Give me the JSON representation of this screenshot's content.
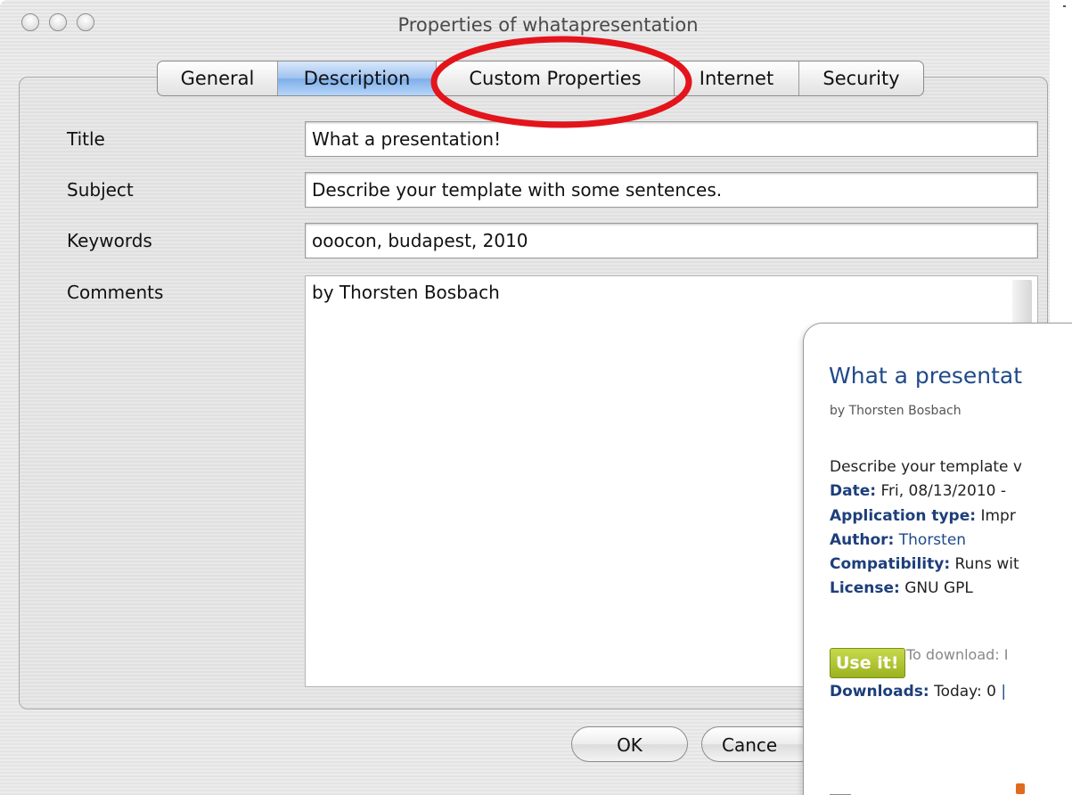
{
  "window": {
    "title": "Properties of whatapresentation"
  },
  "tabs": [
    {
      "label": "General",
      "selected": false
    },
    {
      "label": "Description",
      "selected": true
    },
    {
      "label": "Custom Properties",
      "selected": false
    },
    {
      "label": "Internet",
      "selected": false
    },
    {
      "label": "Security",
      "selected": false
    }
  ],
  "fields": {
    "title": {
      "label": "Title",
      "value": "What a presentation!"
    },
    "subject": {
      "label": "Subject",
      "value": "Describe your template with some sentences."
    },
    "keywords": {
      "label": "Keywords",
      "value": "ooocon, budapest, 2010"
    },
    "comments": {
      "label": "Comments",
      "value": "by Thorsten Bosbach"
    }
  },
  "buttons": {
    "ok": "OK",
    "cancel": "Cance"
  },
  "annotation": {
    "color": "#e3141b",
    "target": "Custom Properties"
  },
  "card": {
    "title": "What a presentat",
    "byline": "by Thorsten Bosbach",
    "description": "Describe your template v",
    "date_key": "Date:",
    "date_value": " Fri, 08/13/2010 -",
    "app_type_key": "Application type:",
    "app_type_value": " Impr",
    "author_key": "Author:",
    "author_value": " Thorsten",
    "compat_key": "Compatibility:",
    "compat_value": " Runs wit",
    "license_key": "License:",
    "license_value": " GNU GPL",
    "use_it_label": "Use it!",
    "download_note": "To download: I",
    "downloads_key": "Downloads:",
    "downloads_value": " Today: 0 ",
    "downloads_sep": "|"
  },
  "colors": {
    "selected_tab": "#9fc2ef",
    "card_link": "#1f4a8a",
    "card_key": "#1d3f7a",
    "use_it": "#9cb320"
  }
}
